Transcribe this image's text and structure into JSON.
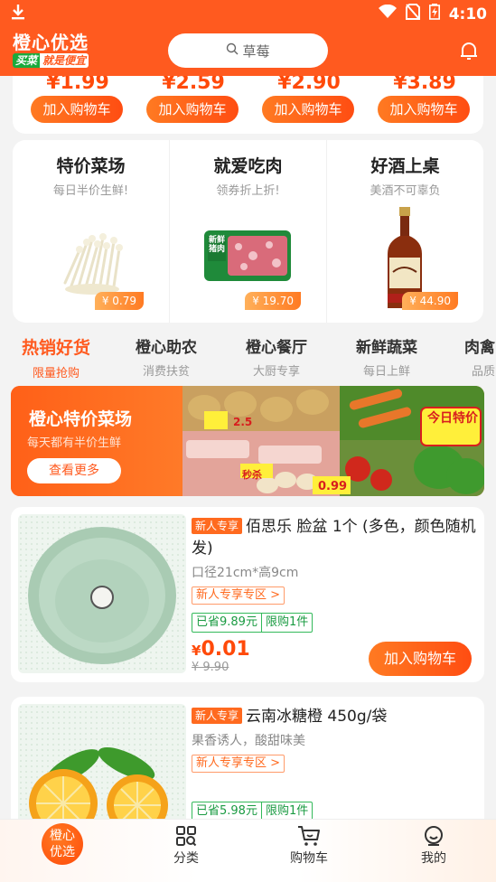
{
  "status_bar": {
    "time": "4:10"
  },
  "header": {
    "logo_main": "橙心优选",
    "logo_sub_a": "买菜",
    "logo_sub_b": "就是便宜",
    "search_placeholder": "草莓"
  },
  "price_row": [
    {
      "price": "¥1.99",
      "button": "加入购物车"
    },
    {
      "price": "¥2.59",
      "button": "加入购物车"
    },
    {
      "price": "¥2.90",
      "button": "加入购物车"
    },
    {
      "price": "¥3.89",
      "button": "加入购物车"
    }
  ],
  "features": [
    {
      "title": "特价菜场",
      "subtitle": "每日半价生鲜!",
      "price": "¥ 0.79"
    },
    {
      "title": "就爱吃肉",
      "subtitle": "领券折上折!",
      "price": "¥ 19.70",
      "pack_label": "新鲜猪肉"
    },
    {
      "title": "好酒上桌",
      "subtitle": "美酒不可辜负",
      "price": "¥ 44.90"
    }
  ],
  "categories": [
    {
      "title": "热销好货",
      "subtitle": "限量抢购",
      "active": true
    },
    {
      "title": "橙心助农",
      "subtitle": "消费扶贫"
    },
    {
      "title": "橙心餐厅",
      "subtitle": "大厨专享"
    },
    {
      "title": "新鲜蔬菜",
      "subtitle": "每日上鲜"
    },
    {
      "title": "肉禽",
      "subtitle": "品质"
    }
  ],
  "banner": {
    "title": "橙心特价菜场",
    "subtitle": "每天都有半价生鲜",
    "button": "查看更多",
    "art_tags": [
      "2.5",
      "秒杀",
      "0.99",
      "今日特价"
    ]
  },
  "products": [
    {
      "tag": "新人专享",
      "title": "佰思乐 脸盆 1个 (多色，颜色随机发)",
      "spec": "口径21cm*高9cm",
      "zone": "新人专享专区 >",
      "saved": "已省9.89元",
      "limit": "限购1件",
      "price_symbol": "¥",
      "price": "0.01",
      "old_price": "¥ 9.90",
      "cart": "加入购物车"
    },
    {
      "tag": "新人专享",
      "title": "云南冰糖橙 450g/袋",
      "spec": "果香诱人，酸甜味美",
      "zone": "新人专享专区 >",
      "saved": "已省5.98元",
      "limit": "限购1件"
    }
  ],
  "bottom_nav": {
    "home": "橙心优选",
    "category": "分类",
    "cart": "购物车",
    "mine": "我的"
  },
  "colors": {
    "brand": "#ff5a1f",
    "price": "#ff4a0a",
    "green": "#1a9b42"
  }
}
